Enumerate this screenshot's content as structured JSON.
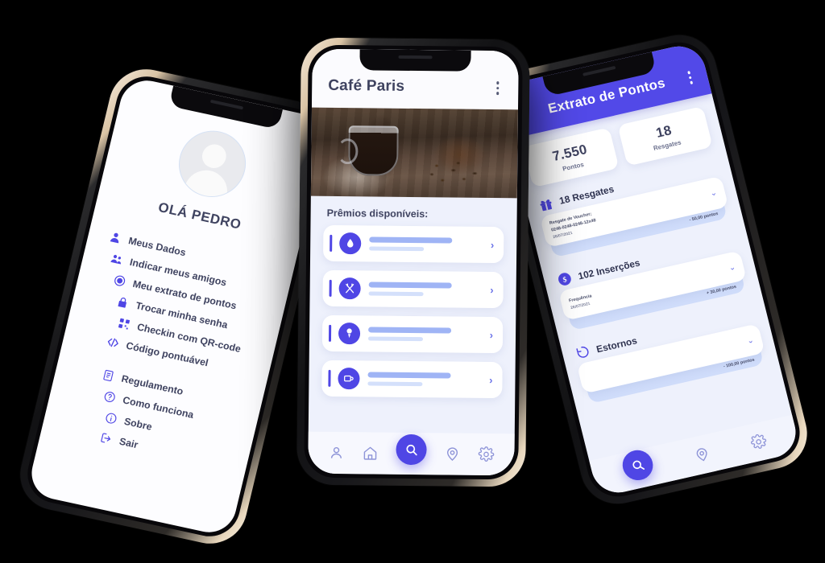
{
  "theme": {
    "accent": "#4f46e5",
    "accent_dark": "#5249e8",
    "text_dark": "#3f4360",
    "screen_bg": "#eef1fc",
    "background": "#000000"
  },
  "phone_left": {
    "name": "profile-menu-screen",
    "avatar": {
      "icon": "user-avatar-placeholder",
      "alt": ""
    },
    "greeting": "OLÁ PEDRO",
    "menu": [
      {
        "icon": "person-icon",
        "label": "Meus Dados"
      },
      {
        "icon": "people-icon",
        "label": "Indicar meus amigos"
      },
      {
        "icon": "coin-icon",
        "label": "Meu extrato de pontos"
      },
      {
        "icon": "lock-icon",
        "label": "Trocar minha senha"
      },
      {
        "icon": "qrcode-icon",
        "label": "Checkin com QR-code"
      },
      {
        "icon": "code-icon",
        "label": "Código pontuável"
      },
      {
        "icon": "document-icon",
        "label": "Regulamento"
      },
      {
        "icon": "question-icon",
        "label": "Como funciona"
      },
      {
        "icon": "info-icon",
        "label": "Sobre"
      },
      {
        "icon": "logout-icon",
        "label": "Sair"
      }
    ]
  },
  "phone_center": {
    "name": "store-rewards-screen",
    "header": {
      "title": "Café Paris",
      "menu_icon": "kebab-menu-icon"
    },
    "hero": {
      "icon": "coffee-photo",
      "alt": ""
    },
    "section_title": "Prêmios disponíveis:",
    "prizes": [
      {
        "icon": "drop-icon",
        "chevron": "›"
      },
      {
        "icon": "cutlery-icon",
        "chevron": "›"
      },
      {
        "icon": "icecream-icon",
        "chevron": "›"
      },
      {
        "icon": "coffee-cup-icon",
        "chevron": "›"
      }
    ],
    "bottom_nav": [
      {
        "icon": "person-outline-icon",
        "active": false
      },
      {
        "icon": "home-outline-icon",
        "active": false
      },
      {
        "icon": "search-icon",
        "active": true
      },
      {
        "icon": "location-pin-icon",
        "active": false
      },
      {
        "icon": "gear-icon",
        "active": false
      }
    ]
  },
  "phone_right": {
    "name": "points-statement-screen",
    "appbar": {
      "back_icon": "back-arrow-icon",
      "title": "Extrato de Pontos",
      "menu_icon": "kebab-menu-icon"
    },
    "stats": [
      {
        "value": "7.550",
        "label": "Pontos"
      },
      {
        "value": "18",
        "label": "Resgates"
      }
    ],
    "sections": [
      {
        "icon": "gift-icon",
        "title": "18 Resgates",
        "items": [
          {
            "line1": "Resgate de Voucher;",
            "line2": "0248-0248-0248-12x48",
            "line3": "26/07/2021",
            "caret": "⌄",
            "amount": "- 50,00 pontos"
          }
        ]
      },
      {
        "icon": "coin-icon",
        "title": "102 Inserções",
        "items": [
          {
            "line1": "Frequência",
            "line2": "",
            "line3": "26/07/2021",
            "caret": "⌄",
            "amount": "+ 30,00 pontos"
          }
        ]
      },
      {
        "icon": "refund-icon",
        "title": "Estornos",
        "items": [
          {
            "line1": "",
            "line2": "",
            "line3": "",
            "caret": "⌄",
            "amount": "- 100,00 pontos"
          }
        ]
      }
    ],
    "bottom_nav": [
      {
        "icon": "search-icon",
        "active": true
      },
      {
        "icon": "location-pin-icon",
        "active": false
      },
      {
        "icon": "gear-icon",
        "active": false
      }
    ]
  }
}
